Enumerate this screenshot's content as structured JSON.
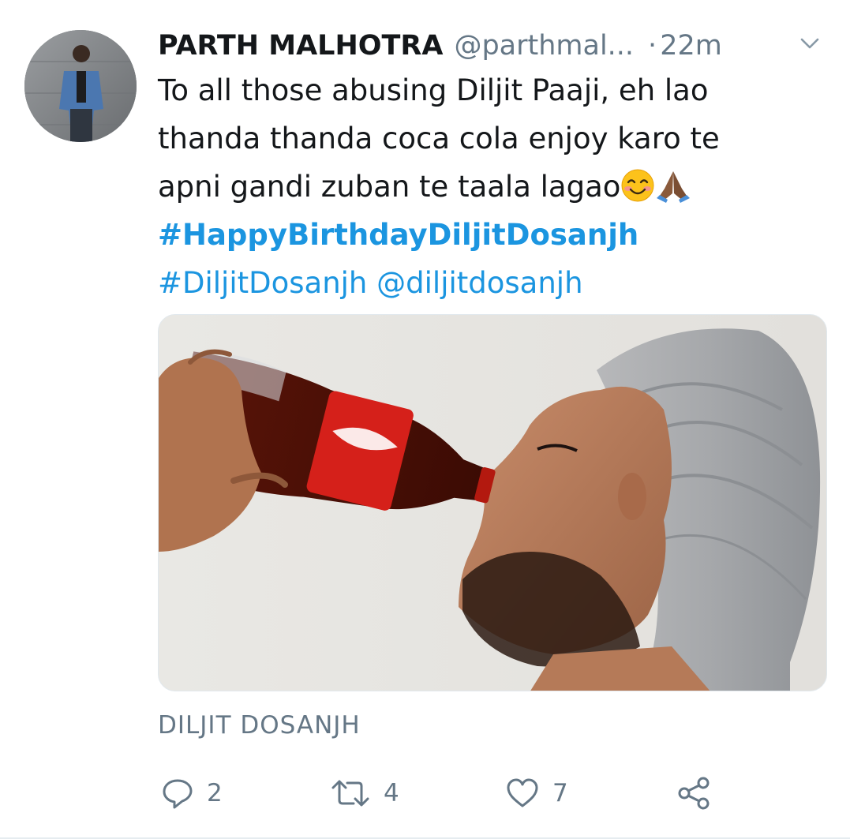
{
  "tweet": {
    "author": {
      "name": "PARTH MALHOTRA",
      "handle": "@parthmal...",
      "separator": "·",
      "time": "22m"
    },
    "text": {
      "line1": "To all those abusing Diljit Paaji, eh lao",
      "line2": "thanda thanda coca cola enjoy karo te",
      "line3": "apni gandi zuban te taala lagao",
      "hashtag1": "#HappyBirthdayDiljitDosanjh",
      "hashtag2": "#DiljitDosanjh",
      "mention": "@diljitdosanjh"
    },
    "card_source": "DILJIT DOSANJH",
    "actions": {
      "reply_count": "2",
      "retweet_count": "4",
      "like_count": "7"
    },
    "icons": {
      "menu": "chevron-down-icon",
      "reply": "reply-icon",
      "retweet": "retweet-icon",
      "like": "heart-icon",
      "share": "share-icon",
      "emoji1": "smiling-face-emoji",
      "emoji2": "folded-hands-emoji"
    },
    "colors": {
      "link": "#1b95e0",
      "secondary_text": "#657786",
      "primary_text": "#14171a"
    }
  }
}
